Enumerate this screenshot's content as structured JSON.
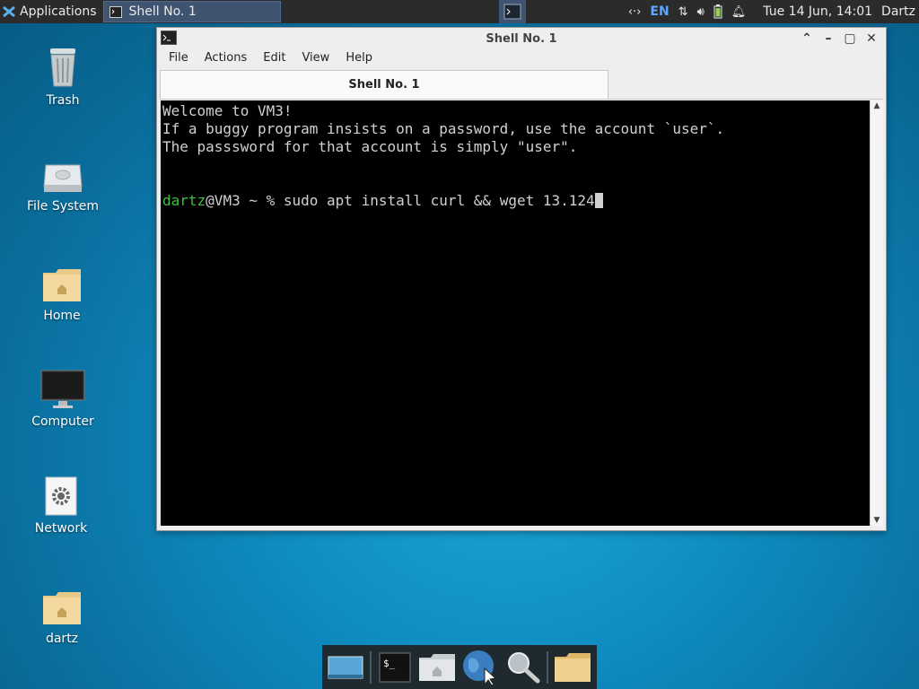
{
  "panel": {
    "applications_label": "Applications",
    "task_label": "Shell No. 1",
    "keyboard_layout": "EN",
    "clock": "Tue 14 Jun, 14:01",
    "user": "Dartz"
  },
  "desktop_icons": [
    {
      "label": "Trash",
      "icon": "trash-icon"
    },
    {
      "label": "File System",
      "icon": "drive-icon"
    },
    {
      "label": "Home",
      "icon": "home-folder-icon"
    },
    {
      "label": "Computer",
      "icon": "monitor-icon"
    },
    {
      "label": "Network",
      "icon": "network-gear-icon"
    },
    {
      "label": "dartz",
      "icon": "home-folder-icon"
    }
  ],
  "window": {
    "title": "Shell No. 1",
    "menu": [
      "File",
      "Actions",
      "Edit",
      "View",
      "Help"
    ],
    "tab_label": "Shell No. 1",
    "terminal": {
      "line1": "Welcome to VM3!",
      "line2": "If a buggy program insists on a password, use the account `user`.",
      "line3": "The passsword for that account is simply \"user\".",
      "prompt_user": "dartz",
      "prompt_rest": "@VM3 ~ % ",
      "command": "sudo apt install curl && wget 13.124"
    }
  },
  "dock": [
    "show-desktop-icon",
    "terminal-icon",
    "file-manager-icon",
    "web-browser-icon",
    "app-finder-icon",
    "folder-icon"
  ],
  "colors": {
    "accent": "#3f5470",
    "prompt_green": "#3fbf3f",
    "desktop": "#0f8cc0"
  }
}
